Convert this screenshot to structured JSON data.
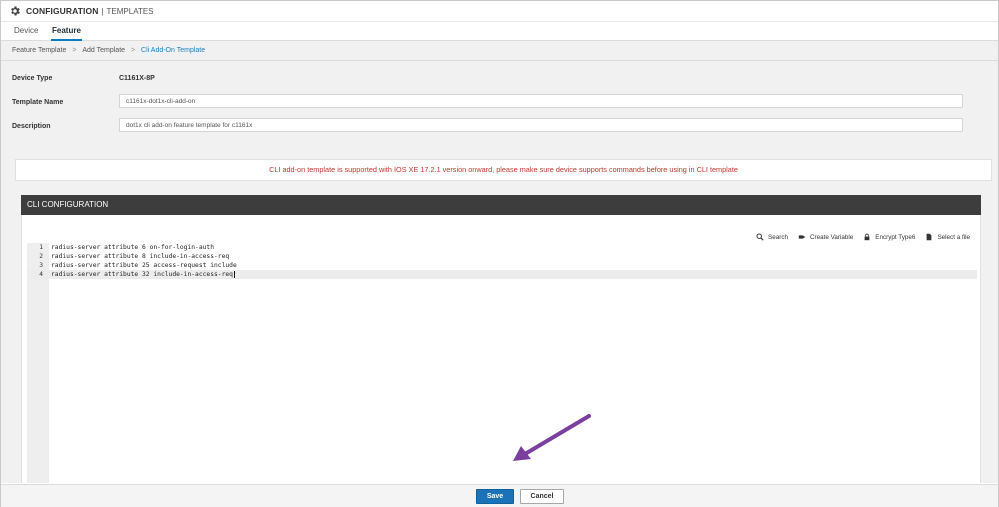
{
  "header": {
    "title_bold": "CONFIGURATION",
    "title_sep": "|",
    "title_sub": "TEMPLATES",
    "icon": "gear-icon"
  },
  "tabs": [
    {
      "label": "Device",
      "active": false
    },
    {
      "label": "Feature",
      "active": true
    }
  ],
  "breadcrumb": {
    "items": [
      "Feature Template",
      "Add Template",
      "Cli Add-On Template"
    ],
    "separator": ">"
  },
  "form": {
    "device_type_label": "Device Type",
    "device_type_value": "C1161X-8P",
    "template_name_label": "Template Name",
    "template_name_value": "c1161x-dot1x-cli-add-on",
    "description_label": "Description",
    "description_value": "dot1x cli add-on feature template for c1161x"
  },
  "notice": "CLI add-on template is supported with IOS XE 17.2.1 version onward, please make sure device supports commands before using in CLI template",
  "cli": {
    "title": "CLI CONFIGURATION",
    "tools": [
      {
        "label": "Search",
        "icon": "search-icon"
      },
      {
        "label": "Create Variable",
        "icon": "tag-icon"
      },
      {
        "label": "Encrypt Type6",
        "icon": "lock-icon"
      },
      {
        "label": "Select a file",
        "icon": "file-icon"
      }
    ],
    "lines": [
      {
        "num": "1",
        "text": "radius-server attribute 6 on-for-login-auth"
      },
      {
        "num": "2",
        "text": "radius-server attribute 8 include-in-access-req"
      },
      {
        "num": "3",
        "text": "radius-server attribute 25 access-request include"
      },
      {
        "num": "4",
        "text": "radius-server attribute 32 include-in-access-req"
      }
    ],
    "active_line": 4
  },
  "footer": {
    "save_label": "Save",
    "cancel_label": "Cancel"
  },
  "colors": {
    "accent": "#1a73b8",
    "notice": "#c0392b",
    "annotation_arrow": "#7b3fa0",
    "cli_header": "#3d3d3d"
  }
}
